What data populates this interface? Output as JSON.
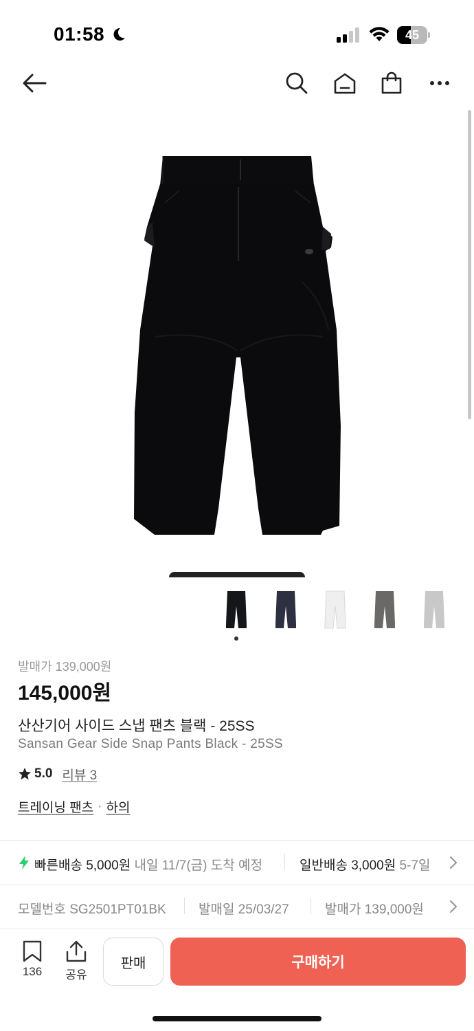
{
  "status_bar": {
    "time": "01:58",
    "battery": "45",
    "battery_level": 0.45
  },
  "nav": {
    "back_icon": "arrow-left-icon",
    "search_icon": "search-icon",
    "home_icon": "home-icon",
    "cart_icon": "shopping-bag-icon",
    "more_icon": "more-dots-icon"
  },
  "product_image": {
    "alt": "black pants"
  },
  "color_options": [
    {
      "color": "#15161a"
    },
    {
      "color": "#2d3040"
    },
    {
      "color": "#efefef"
    },
    {
      "color": "#6a6967"
    },
    {
      "color": "#c8c8c8"
    }
  ],
  "product": {
    "release_price": "발매가 139,000원",
    "price": "145,000원",
    "name_ko": "산산기어 사이드 스냅 팬츠 블랙 - 25SS",
    "name_en": "Sansan Gear Side Snap Pants Black - 25SS",
    "rating": "5.0",
    "review": "리뷰 3",
    "category": "트레이닝 팬츠",
    "category_sep": "·",
    "category_parent": "하의"
  },
  "shipping": {
    "fast_label": "빠른배송 5,000원",
    "fast_eta": "내일 11/7(금) 도착 예정",
    "normal_label": "일반배송 3,000원",
    "normal_eta": "5-7일"
  },
  "meta": {
    "model": "모델번호 SG2501PT01BK",
    "release_date": "발매일 25/03/27",
    "release_price": "발매가 139,000원"
  },
  "bottom_bar": {
    "bookmark_count": "136",
    "share_label": "공유",
    "sell_label": "판매",
    "buy_label": "구매하기"
  },
  "colors": {
    "accent": "#ef6253",
    "bolt": "#2ecc71"
  }
}
